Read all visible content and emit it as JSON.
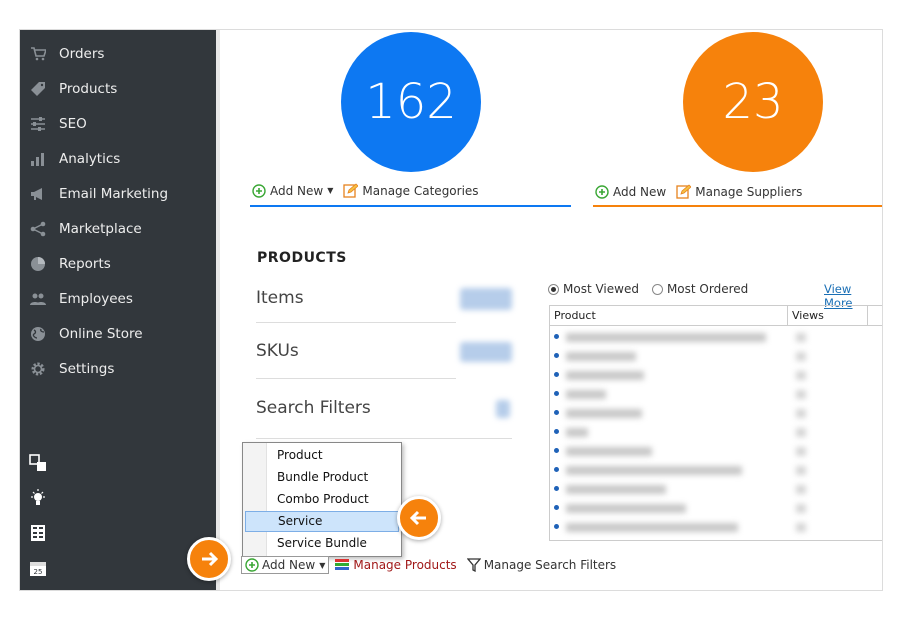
{
  "sidebar": {
    "items": [
      {
        "label": "Orders",
        "icon": "cart-icon"
      },
      {
        "label": "Products",
        "icon": "tag-icon"
      },
      {
        "label": "SEO",
        "icon": "sliders-icon"
      },
      {
        "label": "Analytics",
        "icon": "bar-chart-icon"
      },
      {
        "label": "Email Marketing",
        "icon": "megaphone-icon"
      },
      {
        "label": "Marketplace",
        "icon": "share-icon"
      },
      {
        "label": "Reports",
        "icon": "pie-chart-icon"
      },
      {
        "label": "Employees",
        "icon": "users-icon"
      },
      {
        "label": "Online Store",
        "icon": "globe-icon"
      },
      {
        "label": "Settings",
        "icon": "gear-icon"
      }
    ],
    "bottom_icons": [
      "layout-icon",
      "lightbulb-icon",
      "calculator-icon",
      "calendar-icon"
    ],
    "calendar_day": "25"
  },
  "categories": {
    "count": "162",
    "color": "#0d78f2",
    "add_new_label": "Add New",
    "manage_label": "Manage Categories"
  },
  "suppliers": {
    "count": "23",
    "color": "#f6820c",
    "add_new_label": "Add New",
    "manage_label": "Manage Suppliers"
  },
  "products": {
    "title": "PRODUCTS",
    "stats": [
      {
        "label": "Items"
      },
      {
        "label": "SKUs"
      },
      {
        "label": "Search Filters"
      }
    ],
    "radio_most_viewed": "Most Viewed",
    "radio_most_ordered": "Most Ordered",
    "view_more": "View More",
    "grid_headers": {
      "product": "Product",
      "views": "Views"
    },
    "row_count": 11
  },
  "dropdown": {
    "items": [
      "Product",
      "Bundle Product",
      "Combo Product",
      "Service",
      "Service Bundle"
    ],
    "selected": "Service"
  },
  "bottom_bar": {
    "add_new_label": "Add New",
    "manage_products": "Manage Products",
    "manage_search_filters": "Manage Search Filters"
  }
}
